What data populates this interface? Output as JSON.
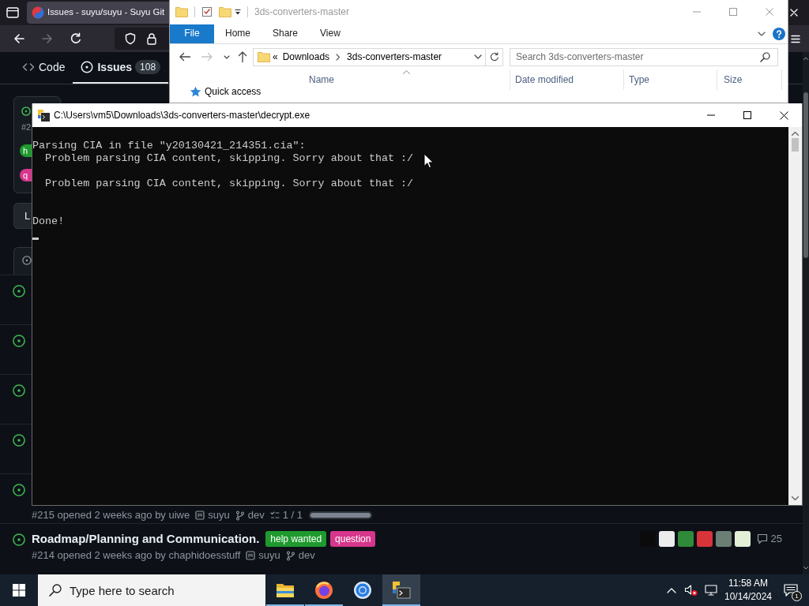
{
  "browser": {
    "tab": {
      "title": "Issues - suyu/suyu - Suyu Git",
      "selected": true
    },
    "nav_buttons": [
      {
        "kind": "back",
        "disabled": false
      },
      {
        "kind": "forward",
        "disabled": true
      },
      {
        "kind": "reload",
        "disabled": false
      }
    ],
    "repo_tabs": [
      {
        "kind": "code",
        "label": "Code",
        "selected": false
      },
      {
        "kind": "issues",
        "label": "Issues",
        "count": "108",
        "selected": true
      }
    ],
    "pinned_issue": {
      "open": true,
      "number": "#2",
      "labels": [
        {
          "text": "h",
          "color": "#1f9a2e"
        },
        {
          "text": "q",
          "color": "#d6368c"
        }
      ]
    },
    "list_button": {
      "label": "L"
    },
    "issues": [
      {
        "open": true
      },
      {
        "open": true
      },
      {
        "open": true
      },
      {
        "open": true
      },
      {
        "open": true,
        "meta": "#215 opened 2 weeks ago by uiwe",
        "project": "suyu",
        "branch": "dev",
        "tasks": "1 / 1",
        "level": 1
      },
      {
        "open": true,
        "title": "Roadmap/Planning and Communication.",
        "labels": [
          {
            "text": "help wanted",
            "color": "#1f9a2e"
          },
          {
            "text": "question",
            "color": "#d6368c"
          }
        ],
        "meta": "#214 opened 2 weeks ago by chaphidoesstuff",
        "project": "suyu",
        "branch": "dev",
        "participants": [
          {
            "color": "#0b0b0b"
          },
          {
            "color": "#ececec"
          },
          {
            "color": "#2f8a3a"
          },
          {
            "color": "#d8343a"
          },
          {
            "color": "#6b7f74"
          },
          {
            "color": "#e4efd8"
          }
        ],
        "comments": "25"
      }
    ]
  },
  "explorer": {
    "title": "3ds-converters-master",
    "active": false,
    "ribbon_tabs": [
      {
        "label": "File",
        "selected": true
      },
      {
        "label": "Home",
        "selected": false
      },
      {
        "label": "Share",
        "selected": false
      },
      {
        "label": "View",
        "selected": false
      }
    ],
    "nav_buttons": [
      {
        "kind": "back",
        "disabled": false
      },
      {
        "kind": "forward",
        "disabled": true
      },
      {
        "kind": "recent",
        "disabled": false
      },
      {
        "kind": "up",
        "disabled": false
      }
    ],
    "address": {
      "prefix": "«",
      "crumbs": [
        "Downloads",
        "3ds-converters-master"
      ]
    },
    "search": {
      "placeholder": "Search 3ds-converters-master"
    },
    "columns": [
      {
        "label": "Name",
        "sorted": true
      },
      {
        "label": "Date modified",
        "sorted": false
      },
      {
        "label": "Type",
        "sorted": false
      },
      {
        "label": "Size",
        "sorted": false
      }
    ],
    "nav_pane": [
      {
        "label": "Quick access"
      }
    ]
  },
  "console": {
    "title": "C:\\Users\\vm5\\Downloads\\3ds-converters-master\\decrypt.exe",
    "active": true,
    "lines": [
      {
        "kind": "blank"
      },
      {
        "kind": "text",
        "text": "Parsing CIA in file \"y20130421_214351.cia\":"
      },
      {
        "kind": "text",
        "text": "  Problem parsing CIA content, skipping. Sorry about that :/"
      },
      {
        "kind": "blank"
      },
      {
        "kind": "text",
        "text": "  Problem parsing CIA content, skipping. Sorry about that :/"
      },
      {
        "kind": "blank"
      },
      {
        "kind": "blank"
      },
      {
        "kind": "text",
        "text": "Done!"
      }
    ],
    "cursor": true
  },
  "taskbar": {
    "search": {
      "placeholder": "Type here to search"
    },
    "apps": [
      {
        "kind": "folder",
        "running": true,
        "active": false
      },
      {
        "kind": "swirl",
        "running": true,
        "active": false
      },
      {
        "kind": "ring",
        "running": false,
        "active": false
      },
      {
        "kind": "terminal",
        "running": true,
        "active": true
      }
    ],
    "volume_muted": true,
    "clock": {
      "time": "11:58 AM",
      "date": "10/14/2024"
    },
    "notifications": "1"
  }
}
